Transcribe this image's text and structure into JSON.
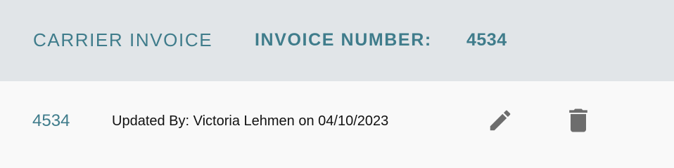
{
  "header": {
    "title": "CARRIER INVOICE",
    "invoice_number_label": "INVOICE NUMBER:",
    "invoice_number_value": "4534"
  },
  "row": {
    "number": "4534",
    "updated_text": "Updated By: Victoria Lehmen on 04/10/2023",
    "edit_icon": "pencil-icon",
    "delete_icon": "trash-icon"
  },
  "colors": {
    "accent": "#3f7c8b",
    "header_bg": "#e1e5e8",
    "row_bg": "#f9f9f9",
    "icon": "#6d6d6d"
  }
}
